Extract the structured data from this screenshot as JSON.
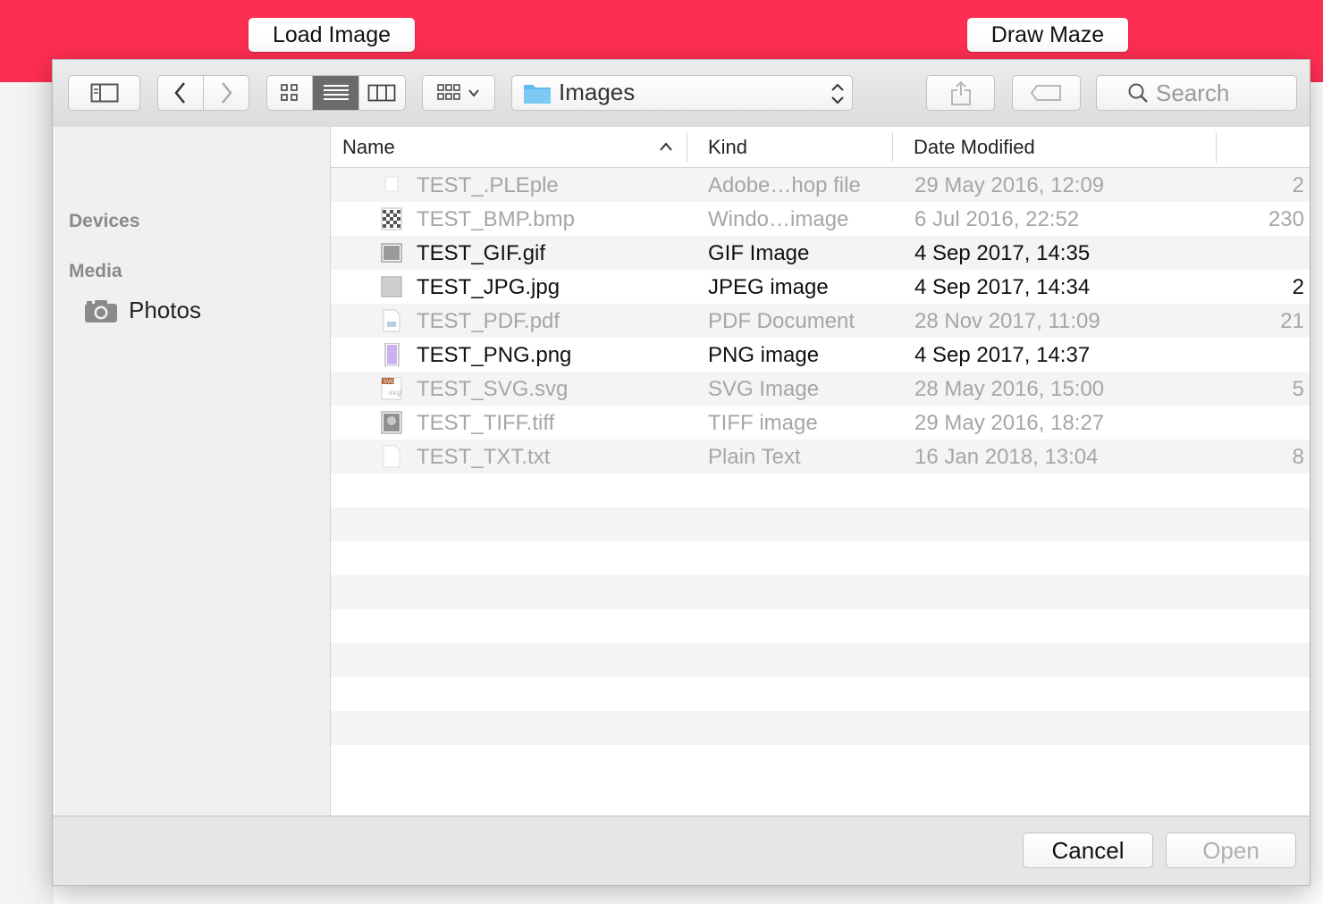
{
  "app": {
    "load_image_label": "Load Image",
    "draw_maze_label": "Draw Maze",
    "accent_color": "#fe2e52"
  },
  "toolbar": {
    "sidebar_toggle_icon": "sidebar-icon",
    "back_icon": "chevron-left-icon",
    "forward_icon": "chevron-right-icon",
    "view_modes": [
      "icon-view",
      "list-view",
      "column-view"
    ],
    "selected_view": "list-view",
    "group_icon": "arrange-icon",
    "location": "Images",
    "share_icon": "share-icon",
    "tag_icon": "tag-icon",
    "search_placeholder": "Search"
  },
  "sidebar": {
    "sections": [
      {
        "title": "Devices",
        "items": []
      },
      {
        "title": "Media",
        "items": [
          {
            "label": "Photos",
            "icon": "camera-icon"
          }
        ]
      }
    ]
  },
  "file_list": {
    "columns": [
      "Name",
      "Kind",
      "Date Modified"
    ],
    "sort_column": "Name",
    "sort_direction": "ascending",
    "files": [
      {
        "name": "TEST_.PLEple",
        "kind": "Adobe…hop file",
        "date": "29 May 2016, 12:09",
        "size": "2",
        "enabled": false,
        "icon": "blank-file-icon"
      },
      {
        "name": "TEST_BMP.bmp",
        "kind": "Windo…image",
        "date": "6 Jul 2016, 22:52",
        "size": "230",
        "enabled": false,
        "icon": "checker-image-icon"
      },
      {
        "name": "TEST_GIF.gif",
        "kind": "GIF Image",
        "date": "4 Sep 2017, 14:35",
        "size": "",
        "enabled": true,
        "icon": "gray-image-icon"
      },
      {
        "name": "TEST_JPG.jpg",
        "kind": "JPEG image",
        "date": "4 Sep 2017, 14:34",
        "size": "2",
        "enabled": true,
        "icon": "noise-image-icon"
      },
      {
        "name": "TEST_PDF.pdf",
        "kind": "PDF Document",
        "date": "28 Nov 2017, 11:09",
        "size": "21",
        "enabled": false,
        "icon": "pdf-document-icon"
      },
      {
        "name": "TEST_PNG.png",
        "kind": "PNG image",
        "date": "4 Sep 2017, 14:37",
        "size": "",
        "enabled": true,
        "icon": "purple-image-icon"
      },
      {
        "name": "TEST_SVG.svg",
        "kind": "SVG Image",
        "date": "28 May 2016, 15:00",
        "size": "5",
        "enabled": false,
        "icon": "svg-document-icon"
      },
      {
        "name": "TEST_TIFF.tiff",
        "kind": "TIFF image",
        "date": "29 May 2016, 18:27",
        "size": "",
        "enabled": false,
        "icon": "photo-image-icon"
      },
      {
        "name": "TEST_TXT.txt",
        "kind": "Plain Text",
        "date": "16 Jan 2018, 13:04",
        "size": "8",
        "enabled": false,
        "icon": "text-file-icon"
      }
    ]
  },
  "footer": {
    "cancel_label": "Cancel",
    "open_label": "Open"
  }
}
